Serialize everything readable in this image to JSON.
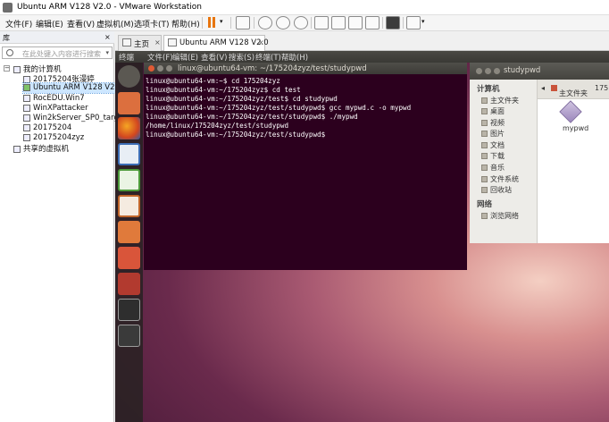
{
  "window": {
    "title": "Ubuntu ARM V128 V2.0 - VMware Workstation"
  },
  "menu": {
    "items": [
      "文件(F)",
      "编辑(E)",
      "查看(V)",
      "虚拟机(M)",
      "选项卡(T)",
      "帮助(H)"
    ]
  },
  "toolbar": {
    "icons": [
      "pause-icon",
      "dropdown-icon",
      "send-keys-icon",
      "snapshot-icon",
      "revert-snapshot-icon",
      "snapshot-manager-icon",
      "show-library-icon",
      "thumbnail-icon",
      "fullscreen-icon",
      "unity-icon",
      "console-view-icon",
      "stretch-view-icon"
    ]
  },
  "library": {
    "header": "库",
    "close": "×",
    "search_placeholder": "在此处键入内容进行搜索",
    "tree": {
      "root": "我的计算机",
      "vms": [
        "20175204张漫婷",
        "Ubuntu ARM V128 V2.0",
        "RocEDU.Win7",
        "WinXPattacker",
        "Win2kServer_SP0_target",
        "20175204",
        "20175204zyz"
      ],
      "shared": "共享的虚拟机"
    }
  },
  "tabs": [
    {
      "label": "主页",
      "close": "×"
    },
    {
      "label": "Ubuntu ARM V128 V2.0",
      "close": "×"
    }
  ],
  "guest": {
    "panel_app": "终端",
    "panel_menus": [
      "文件(F)",
      "编辑(E)",
      "查看(V)",
      "搜索(S)",
      "终端(T)",
      "帮助(H)"
    ],
    "launcher_icons": [
      "ubuntu-dash-icon",
      "home-folder-icon",
      "firefox-icon",
      "writer-icon",
      "calc-icon",
      "impress-icon",
      "software-center-icon",
      "ubuntu-one-icon",
      "settings-icon",
      "terminal-icon",
      "workspace-switcher-icon"
    ],
    "terminal": {
      "title": "linux@ubuntu64-vm: ~/175204zyz/test/studypwd",
      "lines": [
        "linux@ubuntu64-vm:~$ cd 175204zyz",
        "linux@ubuntu64-vm:~/175204zyz$ cd test",
        "linux@ubuntu64-vm:~/175204zyz/test$ cd studypwd",
        "linux@ubuntu64-vm:~/175204zyz/test/studypwd$ gcc mypwd.c -o mypwd",
        "linux@ubuntu64-vm:~/175204zyz/test/studypwd$ ./mypwd",
        "/home/linux/175204zyz/test/studypwd",
        "linux@ubuntu64-vm:~/175204zyz/test/studypwd$"
      ]
    },
    "file_manager": {
      "title": "studypwd",
      "location": [
        "主文件夹",
        "175"
      ],
      "sections": [
        {
          "header": "计算机",
          "items": [
            "主文件夹",
            "桌面",
            "视频",
            "图片",
            "文档",
            "下载",
            "音乐",
            "文件系统",
            "回收站"
          ]
        },
        {
          "header": "网络",
          "items": [
            "浏览网络"
          ]
        }
      ],
      "files": [
        "mypwd"
      ]
    }
  }
}
